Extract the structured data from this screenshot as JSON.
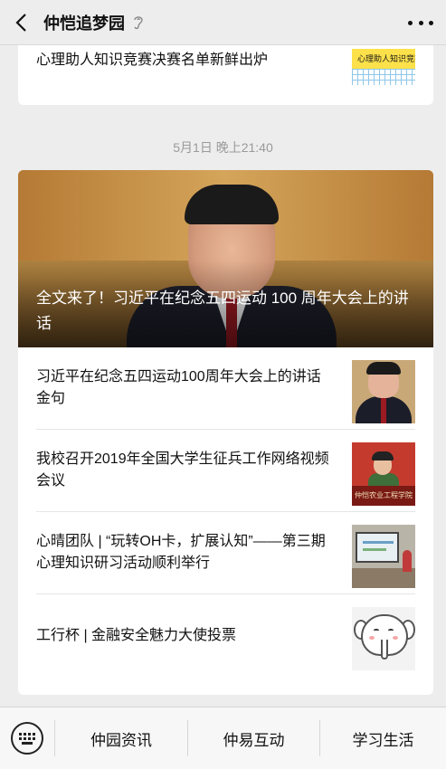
{
  "header": {
    "title": "仲恺追梦园"
  },
  "top_card": {
    "text": "心理助人知识竞赛决赛名单新鲜出炉",
    "thumb_text": "心理助人知识竞赛"
  },
  "timestamp": "5月1日 晚上21:40",
  "main_card": {
    "hero_title": "全文来了！习近平在纪念五四运动 100 周年大会上的讲话",
    "items": [
      {
        "text": "习近平在纪念五四运动100周年大会上的讲话金句"
      },
      {
        "text": "我校召开2019年全国大学生征兵工作网络视频会议",
        "thumb_banner": "仲恺农业工程学院"
      },
      {
        "text": "心晴团队 | “玩转OH卡，扩展认知”——第三期心理知识研习活动顺利举行"
      },
      {
        "text": "工行杯 | 金融安全魅力大使投票"
      }
    ]
  },
  "bottom_menu": {
    "items": [
      "仲园资讯",
      "仲易互动",
      "学习生活"
    ]
  }
}
